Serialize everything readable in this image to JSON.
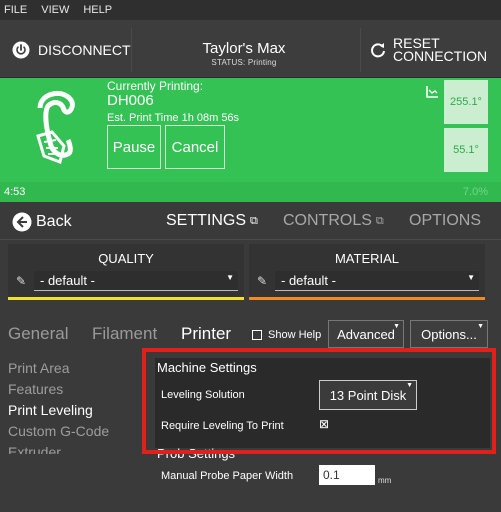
{
  "menu": [
    "FILE",
    "VIEW",
    "HELP"
  ],
  "header": {
    "disconnect_label": "DISCONNECT",
    "printer_name": "Taylor's Max",
    "status": "STATUS: Printing",
    "reset_line1": "RESET",
    "reset_line2": "CONNECTION"
  },
  "printing": {
    "label": "Currently Printing:",
    "job": "DH006",
    "est_time": "Est. Print Time 1h 08m 56s",
    "pause_label": "Pause",
    "cancel_label": "Cancel",
    "temp1": "255.1°",
    "temp2": "55.1°"
  },
  "progress": {
    "elapsed": "4:53",
    "percent_text": "7.0%",
    "percent": 7.0
  },
  "nav": {
    "back_label": "Back",
    "settings_label": "SETTINGS",
    "controls_label": "CONTROLS",
    "options_label": "OPTIONS"
  },
  "quality": {
    "label": "QUALITY",
    "value": "- default -",
    "color": "#f0e030"
  },
  "material": {
    "label": "MATERIAL",
    "value": "- default -",
    "color": "#f08a24"
  },
  "tabs": {
    "general": "General",
    "filament": "Filament",
    "printer": "Printer",
    "show_help": "Show Help",
    "advanced": "Advanced",
    "options": "Options..."
  },
  "leftnav": [
    "Print Area",
    "Features",
    "Print Leveling",
    "Custom G-Code",
    "Extruder"
  ],
  "machine": {
    "section_title": "Machine Settings",
    "leveling_label": "Leveling Solution",
    "leveling_value": "13 Point Disk",
    "require_label": "Require Leveling To Print",
    "require_mark": "⊠"
  },
  "probe": {
    "section_title": "Prob Settings",
    "paper_label": "Manual Probe Paper Width",
    "paper_value": "0.1",
    "unit": "mm"
  },
  "colors": {
    "green": "#34c255",
    "highlight": "#e0201b"
  }
}
